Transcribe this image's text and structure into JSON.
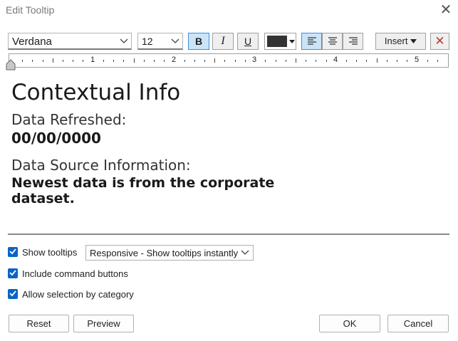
{
  "window": {
    "title": "Edit Tooltip",
    "close_glyph": "✕"
  },
  "toolbar": {
    "font_family": "Verdana",
    "font_size": "12",
    "bold_label": "B",
    "italic_label": "I",
    "underline_label": "U",
    "text_color": "#333333",
    "insert_label": "Insert",
    "clear_glyph": "✕"
  },
  "ruler": {
    "numbers": [
      "1",
      "2",
      "3",
      "4",
      "5"
    ]
  },
  "editor": {
    "heading": "Contextual Info",
    "label1": "Data Refreshed:",
    "value1": "00/00/0000",
    "label2": "Data Source Information:",
    "value2": "Newest data is from the corporate dataset."
  },
  "options": {
    "show_tooltips_label": "Show tooltips",
    "show_tooltips_checked": true,
    "tooltip_mode": "Responsive - Show tooltips instantly",
    "include_commands_label": "Include command buttons",
    "include_commands_checked": true,
    "allow_selection_label": "Allow selection by category",
    "allow_selection_checked": true
  },
  "footer": {
    "reset_label": "Reset",
    "preview_label": "Preview",
    "ok_label": "OK",
    "cancel_label": "Cancel"
  },
  "colors": {
    "accent": "#0a64c8",
    "active_button": "#cce4f7",
    "close_red": "#c0392b"
  }
}
